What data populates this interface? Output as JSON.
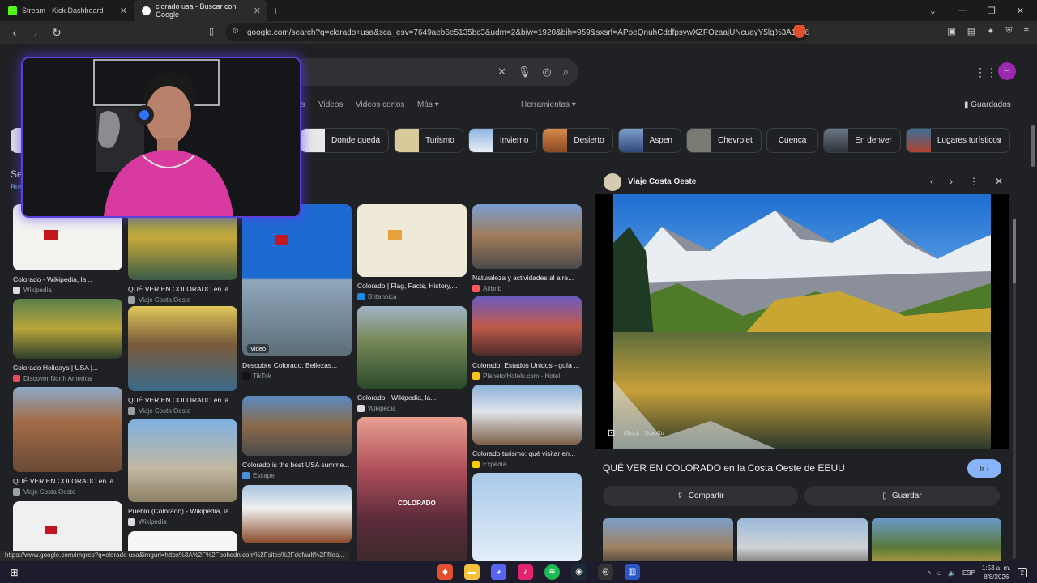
{
  "browser": {
    "tabs": [
      {
        "title": "Stream - Kick Dashboard",
        "active": false,
        "favicon_color": "#53fc18"
      },
      {
        "title": "clorado usa - Buscar con Google",
        "active": true,
        "favicon_color": "#ffffff"
      }
    ],
    "url": "google.com/search?q=clorado+usa&sca_esv=7649aeb6e5135bc3&udm=2&biw=1920&bih=959&sxsrf=APpeQnuhCddfpsywXZFOzaajUNcuayY5lg%3A17861...",
    "status_url": "https://www.google.com/imgres?q=clorado usa&imgurl=https%3A%2F%2Fpohcdn.com%2Fsites%2Fdefault%2Ffiles...",
    "avatar_letter": "H"
  },
  "google": {
    "filters": [
      "es",
      "Videos",
      "Videos cortos",
      "Más ▾",
      "Herramientas ▾"
    ],
    "saved_label": "Guardados",
    "chips": [
      {
        "label": "Donde queda",
        "color": "#e8e8e8"
      },
      {
        "label": "Turismo",
        "color": "#d8c99b"
      },
      {
        "label": "Invierno",
        "color": "#5b82b5"
      },
      {
        "label": "Desierto",
        "color": "#b86b34"
      },
      {
        "label": "Aspen",
        "color": "#4a6a9a"
      },
      {
        "label": "Chevrolet",
        "color": "#7a7a72"
      },
      {
        "label": "Cuenca",
        "color": ""
      },
      {
        "label": "En denver",
        "color": "#3b4450"
      },
      {
        "label": "Lugares turísticos",
        "color": "#2f5f8a"
      }
    ],
    "partial_heading": "Se",
    "partial_sub": "Bus",
    "results": [
      {
        "caption": "Colorado - Wikipedia, la...",
        "source": "Wikipedia"
      },
      {
        "caption": "QUÉ VER EN COLORADO en la...",
        "source": "Viaje Costa Oeste"
      },
      {
        "caption": "Descubre Colorado: Bellezas...",
        "source": "TikTok",
        "badge": "Video"
      },
      {
        "caption": "Colorado | Flag, Facts, History,...",
        "source": "Britannica"
      },
      {
        "caption": "Naturaleza y actividades al aire...",
        "source": "Airbnb"
      },
      {
        "caption": "Colorado Holidays | USA |...",
        "source": "Discover North America"
      },
      {
        "caption": "QUÉ VER EN COLORADO en la...",
        "source": "Viaje Costa Oeste"
      },
      {
        "caption": "Colorado - Wikipedia, la...",
        "source": "Wikipedia"
      },
      {
        "caption": "Colorado, Estados Unidos - guía ...",
        "source": "PlanetofHotels.com - Hotel"
      },
      {
        "caption": "QUÉ VER EN COLORADO en la...",
        "source": "Viaje Costa Oeste"
      },
      {
        "caption": "Colorado is the best USA summe...",
        "source": "Escape"
      },
      {
        "caption": "Colorado turismo: qué visitar en...",
        "source": "Expedia"
      },
      {
        "caption": "Pueblo (Colorado) - Wikipedia, la...",
        "source": "Wikipedia"
      }
    ],
    "colorado_overlay": "COLORADO"
  },
  "panel": {
    "site": "Viaje Costa Oeste",
    "credit": "iStock · ScapXu",
    "caption": "QUÉ VER EN COLORADO en la Costa Oeste de EEUU",
    "go_label": "Ir ›",
    "share_label": "Compartir",
    "save_label": "Guardar"
  },
  "taskbar": {
    "time": "1:53 a. m.",
    "date": "8/8/2026",
    "lang": "ESP",
    "notifications": "2"
  }
}
